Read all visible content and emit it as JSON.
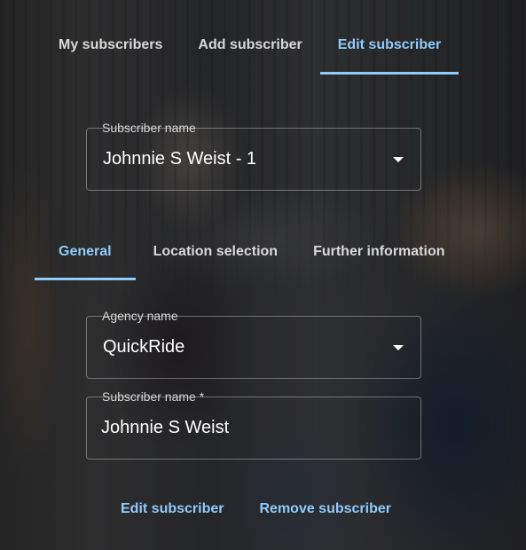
{
  "top_tabs": [
    {
      "label": "My subscribers"
    },
    {
      "label": "Add subscriber"
    },
    {
      "label": "Edit subscriber"
    }
  ],
  "subscriber_select": {
    "label": "Subscriber name",
    "value": "Johnnie S Weist - 1"
  },
  "sub_tabs": [
    {
      "label": "General"
    },
    {
      "label": "Location selection"
    },
    {
      "label": "Further information"
    }
  ],
  "agency_select": {
    "label": "Agency name",
    "value": "QuickRide"
  },
  "subscriber_name_field": {
    "label": "Subscriber name *",
    "value": "Johnnie S Weist"
  },
  "actions": {
    "edit_label": "Edit subscriber",
    "remove_label": "Remove subscriber"
  },
  "colors": {
    "accent": "#90caf9",
    "text": "#ffffff",
    "outline": "rgba(255,255,255,0.35)"
  }
}
